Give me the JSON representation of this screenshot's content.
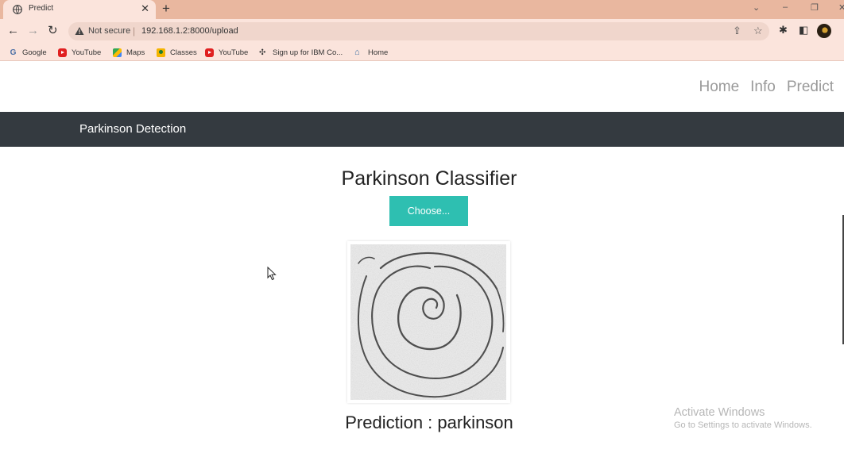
{
  "browser": {
    "tab_title": "Predict",
    "tab_close": "✕",
    "new_tab": "+",
    "security_label": "Not secure",
    "url": "192.168.1.2:8000/upload",
    "bookmarks": [
      {
        "label": "Google",
        "icon": "google-icon"
      },
      {
        "label": "YouTube",
        "icon": "youtube-icon"
      },
      {
        "label": "Maps",
        "icon": "maps-icon"
      },
      {
        "label": "Classes",
        "icon": "classes-icon"
      },
      {
        "label": "YouTube",
        "icon": "youtube-icon"
      },
      {
        "label": "Sign up for IBM Co...",
        "icon": "ibm-icon"
      },
      {
        "label": "Home",
        "icon": "home-icon"
      }
    ]
  },
  "nav": {
    "home": "Home",
    "info": "Info",
    "predict": "Predict"
  },
  "brand": "Parkinson Detection",
  "main": {
    "title": "Parkinson Classifier",
    "choose_label": "Choose...",
    "prediction_text": "Prediction : parkinson"
  },
  "watermark": {
    "title": "Activate Windows",
    "subtitle": "Go to Settings to activate Windows."
  },
  "colors": {
    "tabstrip": "#e9b79f",
    "toolbar": "#fbe4dc",
    "brandbar": "#343a40",
    "accent": "#2ebfb1"
  }
}
